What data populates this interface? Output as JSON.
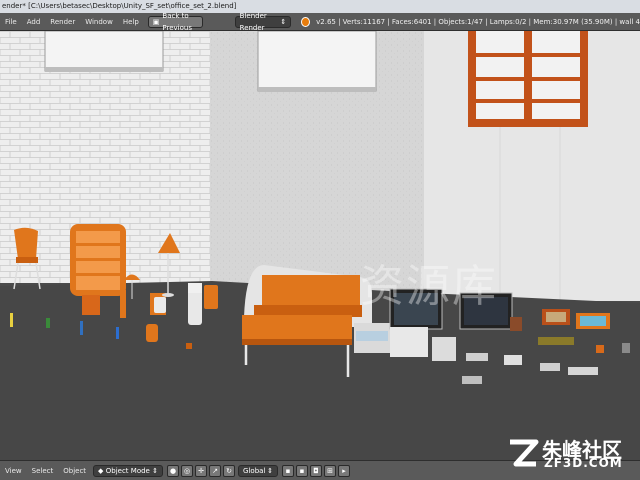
{
  "window": {
    "title": "ender* [C:\\Users\\betasec\\Desktop\\Unity_SF_set\\office_set_2.blend]"
  },
  "header": {
    "menus": [
      "File",
      "Add",
      "Render",
      "Window",
      "Help"
    ],
    "back_button": "Back to Previous",
    "render_engine": "Blender Render",
    "info": "v2.65 | Verts:11167 | Faces:6401 | Objects:1/47 | Lamps:0/2 | Mem:30.97M (35.90M) | wall 4"
  },
  "footer": {
    "menus": [
      "View",
      "Select",
      "Object"
    ],
    "mode": "Object Mode",
    "orientation": "Global"
  },
  "watermark": {
    "center": "资源库",
    "logo_cn": "朱峰社区",
    "logo_en": "ZF3D.COM"
  },
  "colors": {
    "accent": "#e87d0d",
    "furniture_orange": "#e0761c",
    "wall_light": "#e9e9e9",
    "floor": "#4a4a4a"
  }
}
